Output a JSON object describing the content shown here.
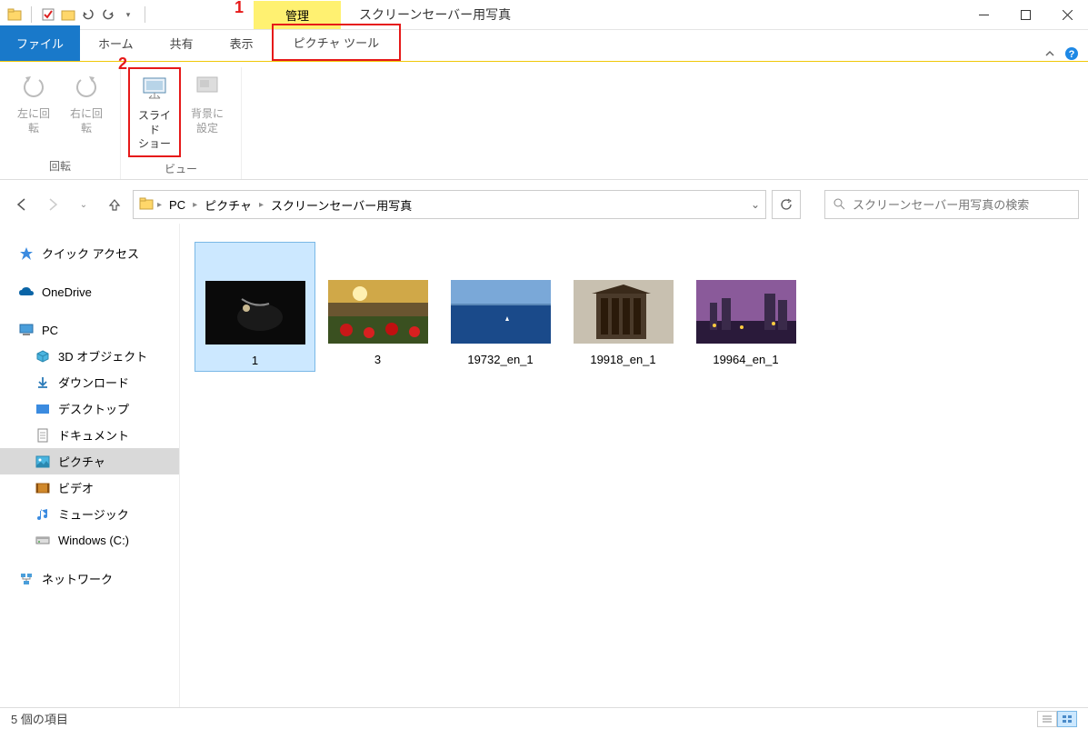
{
  "titlebar": {
    "context_label": "管理",
    "window_title": "スクリーンセーバー用写真"
  },
  "tabs": {
    "file": "ファイル",
    "home": "ホーム",
    "share": "共有",
    "view": "表示",
    "picture_tools": "ピクチャ ツール"
  },
  "annotations": {
    "one": "1",
    "two": "2"
  },
  "ribbon": {
    "rotate_left": "左に回転",
    "rotate_right": "右に回転",
    "slideshow": "スライド\nショー",
    "set_background": "背景に\n設定",
    "group_rotate": "回転",
    "group_view": "ビュー"
  },
  "breadcrumb": {
    "pc": "PC",
    "pictures": "ピクチャ",
    "folder": "スクリーンセーバー用写真"
  },
  "search": {
    "placeholder": "スクリーンセーバー用写真の検索"
  },
  "tree": {
    "quick_access": "クイック アクセス",
    "onedrive": "OneDrive",
    "pc": "PC",
    "objects3d": "3D オブジェクト",
    "downloads": "ダウンロード",
    "desktop": "デスクトップ",
    "documents": "ドキュメント",
    "pictures": "ピクチャ",
    "video": "ビデオ",
    "music": "ミュージック",
    "windows_c": "Windows (C:)",
    "network": "ネットワーク"
  },
  "files": [
    {
      "name": "1"
    },
    {
      "name": "3"
    },
    {
      "name": "19732_en_1"
    },
    {
      "name": "19918_en_1"
    },
    {
      "name": "19964_en_1"
    }
  ],
  "status": {
    "text": "5 個の項目"
  }
}
